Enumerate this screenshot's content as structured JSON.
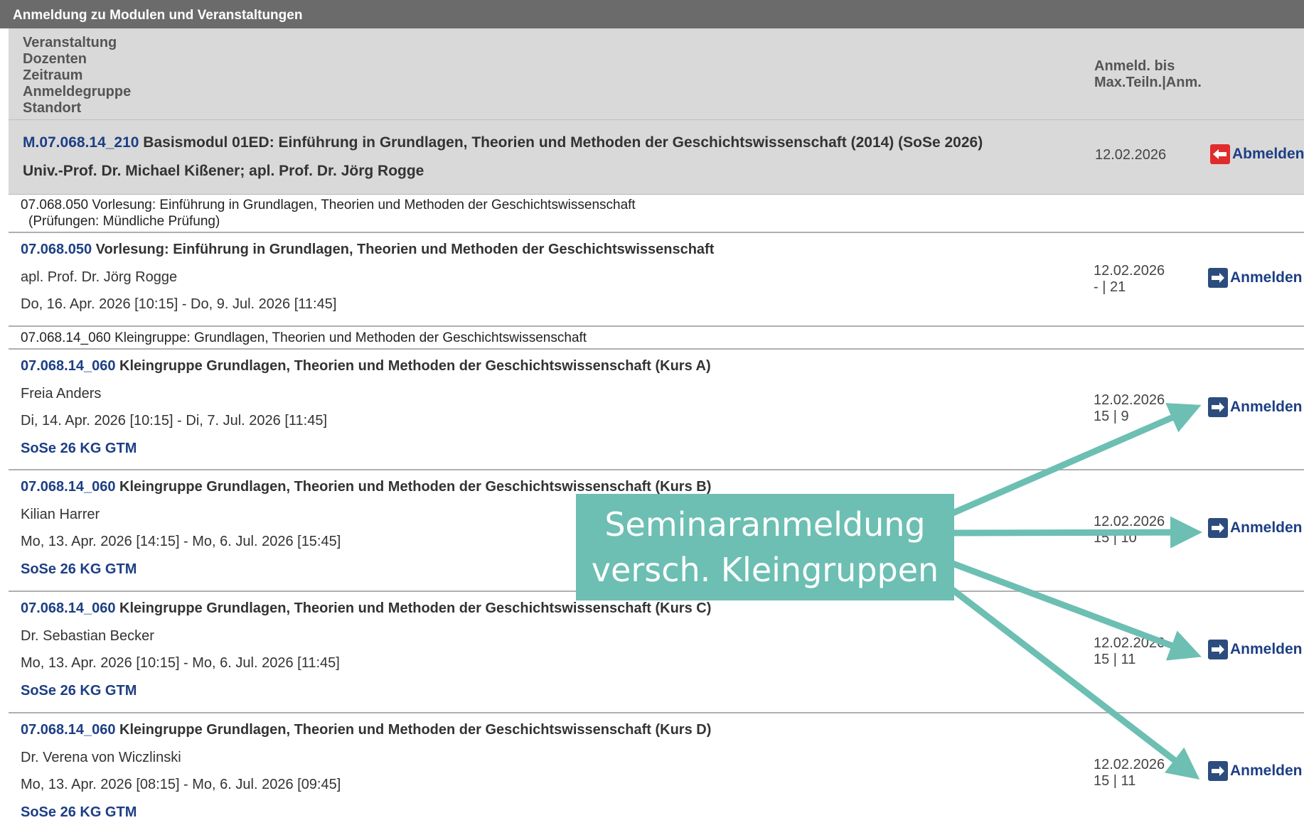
{
  "panel_title": "Anmeldung zu Modulen und Veranstaltungen",
  "header": {
    "col1_line1": "Veranstaltung",
    "col1_line2": "Dozenten",
    "col1_line3": "Zeitraum",
    "col1_line4": "Anmeldegruppe",
    "col1_line5": "Standort",
    "col2_line1": "Anmeld. bis",
    "col2_line2": "Max.Teiln.|Anm."
  },
  "module": {
    "code": "M.07.068.14_210",
    "title": " Basismodul 01ED: Einführung in Grundlagen, Theorien und Methoden der Geschichtswissenschaft (2014) (SoSe 2026)",
    "lecturers": "Univ.-Prof. Dr. Michael Kißener; apl. Prof. Dr. Jörg Rogge",
    "deadline": "12.02.2026",
    "action": "Abmelden"
  },
  "info1": {
    "line1": "07.068.050 Vorlesung: Einführung in Grundlagen, Theorien und Methoden der Geschichtswissenschaft",
    "line2": "(Prüfungen: Mündliche Prüfung)"
  },
  "lecture": {
    "code": "07.068.050",
    "title": " Vorlesung: Einführung in Grundlagen, Theorien und Methoden der Geschichtswissenschaft",
    "lecturer": "apl. Prof. Dr. Jörg Rogge",
    "period": "Do, 16. Apr. 2026 [10:15] - Do, 9. Jul. 2026 [11:45]",
    "deadline": "12.02.2026",
    "capacity": "- | 21",
    "action": "Anmelden"
  },
  "info2": {
    "line1": "07.068.14_060 Kleingruppe: Grundlagen, Theorien und Methoden der Geschichtswissenschaft"
  },
  "courses": [
    {
      "code": "07.068.14_060",
      "title": " Kleingruppe Grundlagen, Theorien und Methoden der Geschichtswissenschaft (Kurs A)",
      "lecturer": "Freia Anders",
      "period": "Di, 14. Apr. 2026 [10:15] - Di, 7. Jul. 2026 [11:45]",
      "group": "SoSe 26 KG GTM",
      "deadline": "12.02.2026",
      "capacity": "15 | 9",
      "action": "Anmelden"
    },
    {
      "code": "07.068.14_060",
      "title": " Kleingruppe Grundlagen, Theorien und Methoden der Geschichtswissenschaft (Kurs B)",
      "lecturer": "Kilian Harrer",
      "period": "Mo, 13. Apr. 2026 [14:15] - Mo, 6. Jul. 2026 [15:45]",
      "group": "SoSe 26 KG GTM",
      "deadline": "12.02.2026",
      "capacity": "15 | 10",
      "action": "Anmelden"
    },
    {
      "code": "07.068.14_060",
      "title": " Kleingruppe Grundlagen, Theorien und Methoden der Geschichtswissenschaft (Kurs C)",
      "lecturer": "Dr. Sebastian Becker",
      "period": "Mo, 13. Apr. 2026 [10:15] - Mo, 6. Jul. 2026 [11:45]",
      "group": "SoSe 26 KG GTM",
      "deadline": "12.02.2026",
      "capacity": "15 | 11",
      "action": "Anmelden"
    },
    {
      "code": "07.068.14_060",
      "title": " Kleingruppe Grundlagen, Theorien und Methoden der Geschichtswissenschaft (Kurs D)",
      "lecturer": "Dr. Verena von Wiczlinski",
      "period": "Mo, 13. Apr. 2026 [08:15] - Mo, 6. Jul. 2026 [09:45]",
      "group": "SoSe 26 KG GTM",
      "deadline": "12.02.2026",
      "capacity": "15 | 11",
      "action": "Anmelden"
    }
  ],
  "callout": {
    "line1": "Seminaranmeldung",
    "line2": "versch. Kleingruppen"
  },
  "colors": {
    "accent": "#6cbfb2",
    "link": "#1d3f84",
    "abmelden_icon": "#e02c2c",
    "anmelden_icon": "#2c4c7e"
  },
  "icons": {
    "abmelden": "arrow-left-icon",
    "anmelden": "arrow-right-icon"
  }
}
